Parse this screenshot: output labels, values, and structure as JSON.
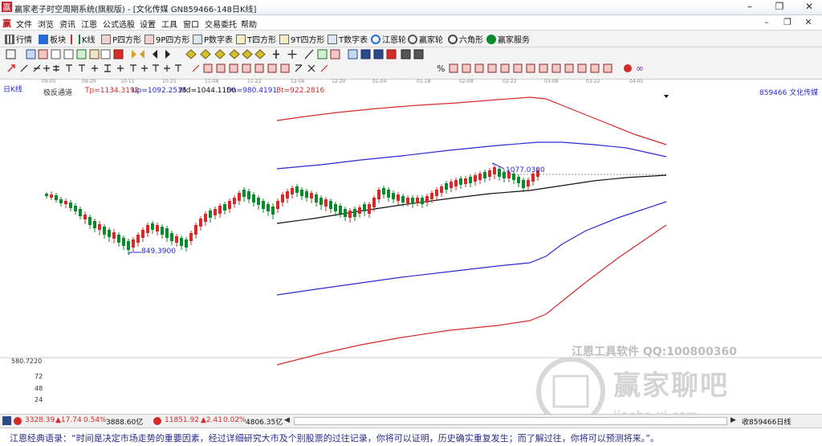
{
  "window": {
    "title": "赢家老子时空周期系统(旗舰版) - [文化传媒  GN859466-148日K线]",
    "buttons": [
      "–",
      "❐",
      "✕"
    ]
  },
  "menu": {
    "logo_text": "赢",
    "items": [
      "文件",
      "浏览",
      "资讯",
      "江恩",
      "公式选股",
      "设置",
      "工具",
      "窗口",
      "交易委托",
      "帮助"
    ],
    "right_buttons": [
      "–",
      "❐",
      "✕"
    ]
  },
  "funcbar": [
    {
      "label": "行情",
      "icon": "grid-icon"
    },
    {
      "label": "板块",
      "icon": "blocks-icon"
    },
    {
      "label": "K线",
      "icon": "kline-icon"
    },
    {
      "label": "P四方形",
      "icon": "p-square-icon"
    },
    {
      "label": "9P四方形",
      "icon": "9p-square-icon"
    },
    {
      "label": "P数字表",
      "icon": "p-table-icon"
    },
    {
      "label": "T四方形",
      "icon": "t-square-icon"
    },
    {
      "label": "9T四方形",
      "icon": "9t-square-icon"
    },
    {
      "label": "T数字表",
      "icon": "t-table-icon"
    },
    {
      "label": "江恩轮",
      "icon": "gann-wheel-icon"
    },
    {
      "label": "赢家轮",
      "icon": "winner-wheel-icon"
    },
    {
      "label": "六角形",
      "icon": "hexagon-icon"
    },
    {
      "label": "赢家服务",
      "icon": "dollar-icon"
    }
  ],
  "datebar": [
    "09-05",
    "09-20",
    "10-11",
    "10-25",
    "11-08",
    "11-22",
    "12-06",
    "12-20",
    "01-04",
    "01-18",
    "02-08",
    "02-22",
    "03-08",
    "03-22",
    "04-05"
  ],
  "chart": {
    "period_label": "日K线",
    "indicator_name": "极反通道",
    "params": {
      "tp": "Tp=1134.3192",
      "up": "Up=1092.2515",
      "md": "Md=1044.1160",
      "dn": "Dn=980.4191",
      "bt": "Bt=922.2816"
    },
    "code_label": "859466  文化传媒",
    "high_label": "1077.0300",
    "low_label": "849.3900",
    "y_labels": [
      "580.7220",
      "72",
      "48",
      "24"
    ],
    "colors": {
      "tp_bt": "#d42a2a",
      "up_dn": "#2a2ad4",
      "md": "#111111",
      "up_candle": "#d42a2a",
      "down_candle": "#0a8a2a"
    }
  },
  "watermark": {
    "line1": "江恩工具软件  QQ:100800360",
    "line2": "赢家聊吧",
    "line3": "jiaoba.yj.com"
  },
  "statusbar": {
    "sh_index": "3328.39",
    "sh_change": "▲17.74",
    "sh_pct": "0.54%",
    "sh_amount": "3888.60亿",
    "sz_index": "11851.92",
    "sz_change": "▲2.41",
    "sz_pct": "0.02%",
    "sz_amount": "4806.35亿",
    "right_label": "收859466日线"
  },
  "quote": "江恩经典语录：“时间是决定市场走势的重要因素，经过详细研究大市及个别股票的过往记录，你将可以证明，历史确实重复发生；而了解过往，你将可以预测将来。”。"
}
